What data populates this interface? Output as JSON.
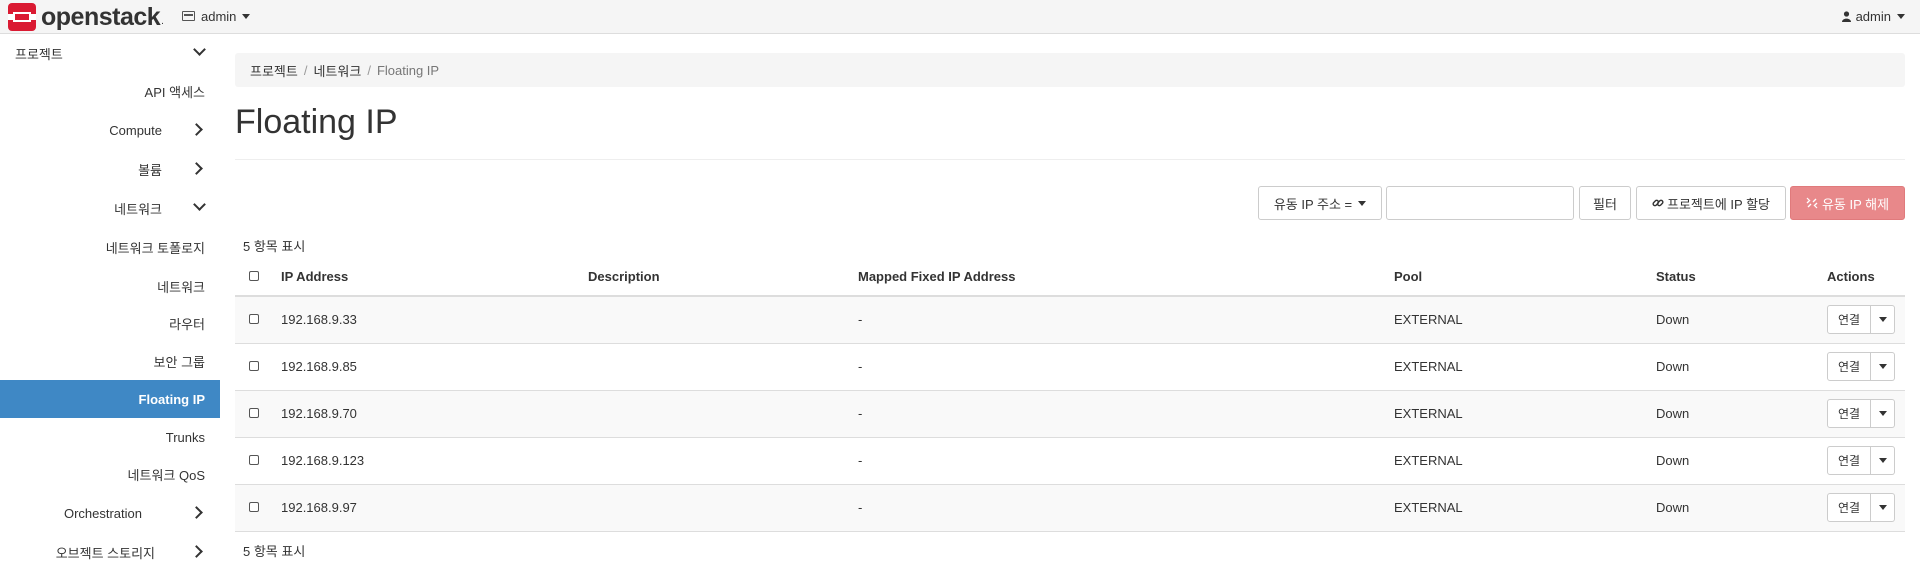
{
  "brand": {
    "name": "openstack",
    "mark": "."
  },
  "topbar": {
    "project_label": "admin",
    "user_label": "admin"
  },
  "sidebar": {
    "items": [
      {
        "label": "프로젝트"
      },
      {
        "label": "API 액세스"
      },
      {
        "label": "Compute"
      },
      {
        "label": "볼륨"
      },
      {
        "label": "네트워크"
      },
      {
        "label": "네트워크 토폴로지"
      },
      {
        "label": "네트워크"
      },
      {
        "label": "라우터"
      },
      {
        "label": "보안 그룹"
      },
      {
        "label": "Floating IP"
      },
      {
        "label": "Trunks"
      },
      {
        "label": "네트워크 QoS"
      },
      {
        "label": "Orchestration"
      },
      {
        "label": "오브젝트 스토리지"
      }
    ]
  },
  "breadcrumb": {
    "items": [
      "프로젝트",
      "네트워크",
      "Floating IP"
    ],
    "separator": "/"
  },
  "page": {
    "title": "Floating IP"
  },
  "toolbar": {
    "filter_field_label": "유동 IP 주소 =",
    "filter_value": "",
    "filter_button": "필터",
    "allocate_button": "프로젝트에 IP 할당",
    "release_button": "유동 IP 해제"
  },
  "table": {
    "count_text": "5 항목 표시",
    "columns": [
      "IP Address",
      "Description",
      "Mapped Fixed IP Address",
      "Pool",
      "Status",
      "Actions"
    ],
    "rows": [
      {
        "ip": "192.168.9.33",
        "description": "",
        "mapped": "-",
        "pool": "EXTERNAL",
        "status": "Down",
        "action": "연결"
      },
      {
        "ip": "192.168.9.85",
        "description": "",
        "mapped": "-",
        "pool": "EXTERNAL",
        "status": "Down",
        "action": "연결"
      },
      {
        "ip": "192.168.9.70",
        "description": "",
        "mapped": "-",
        "pool": "EXTERNAL",
        "status": "Down",
        "action": "연결"
      },
      {
        "ip": "192.168.9.123",
        "description": "",
        "mapped": "-",
        "pool": "EXTERNAL",
        "status": "Down",
        "action": "연결"
      },
      {
        "ip": "192.168.9.97",
        "description": "",
        "mapped": "-",
        "pool": "EXTERNAL",
        "status": "Down",
        "action": "연결"
      }
    ]
  },
  "colors": {
    "active_nav": "#3f88c5",
    "danger": "#e8888a",
    "logo_red": "#da1a32"
  }
}
